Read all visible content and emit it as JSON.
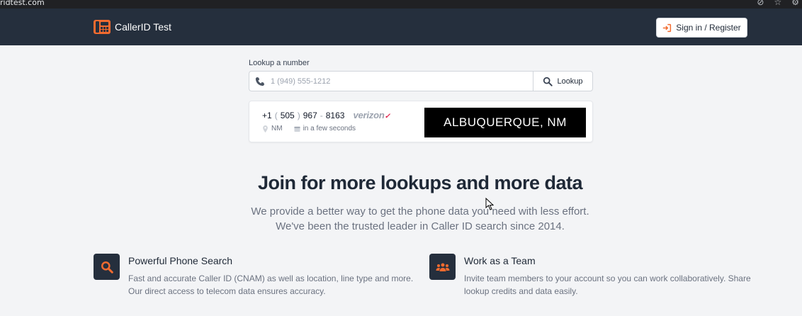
{
  "browser": {
    "url_fragment": "ridtest.com"
  },
  "header": {
    "brand_name": "CallerID Test",
    "signin_label": "Sign in / Register"
  },
  "lookup": {
    "label": "Lookup a number",
    "placeholder": "1 (949) 555-1212",
    "value": "",
    "button_label": "Lookup"
  },
  "result": {
    "phone_prefix": "+1",
    "phone_area_open": "(",
    "phone_area": "505",
    "phone_area_close": ")",
    "phone_exchange": "967",
    "phone_dash": "-",
    "phone_line": "8163",
    "carrier": "verizon",
    "state": "NM",
    "time": "in a few seconds",
    "location": "ALBUQUERQUE, NM"
  },
  "hero": {
    "title": "Join for more lookups and more data",
    "subtitle": "We provide a better way to get the phone data you need with less effort. We've been the trusted leader in Caller ID search since 2014."
  },
  "features": [
    {
      "icon": "search-icon",
      "title": "Powerful Phone Search",
      "description": "Fast and accurate Caller ID (CNAM) as well as location, line type and more. Our direct access to telecom data ensures accuracy."
    },
    {
      "icon": "team-icon",
      "title": "Work as a Team",
      "description": "Invite team members to your account so you can work collaboratively. Share lookup credits and data easily."
    }
  ],
  "colors": {
    "header_bg": "#252f3d",
    "brand_orange": "#f26b2f",
    "page_bg": "#f3f4f6"
  }
}
